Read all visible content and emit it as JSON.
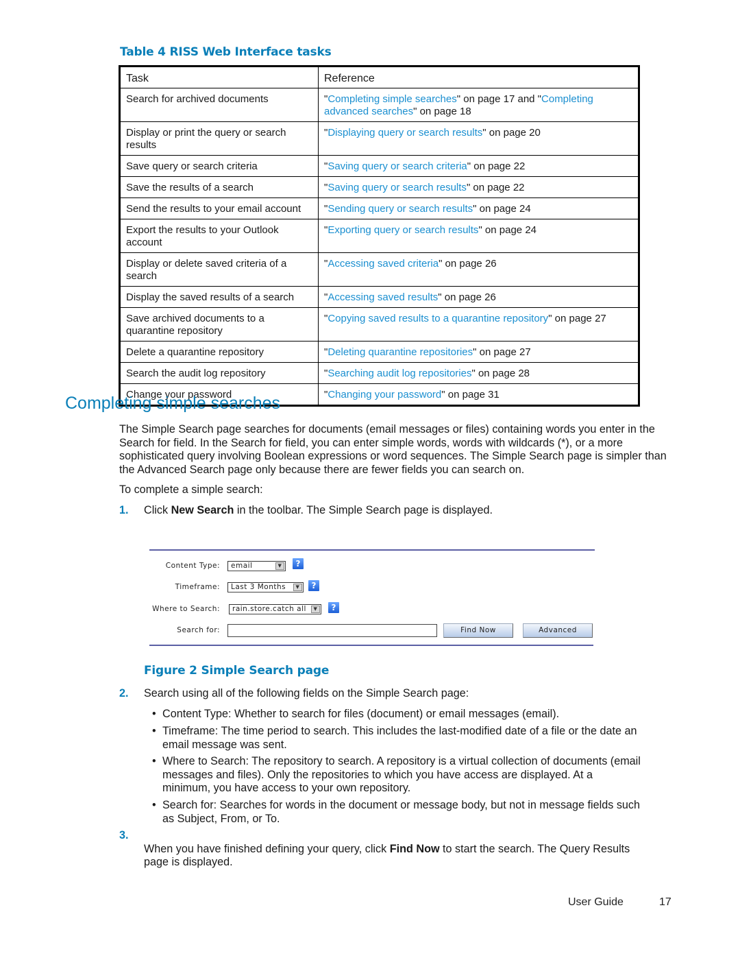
{
  "table": {
    "caption": "Table 4 RISS Web Interface tasks",
    "headers": [
      "Task",
      "Reference"
    ],
    "rows": [
      {
        "task": "Search for archived documents",
        "ref_pre": "\"",
        "link": "Completing simple searches",
        "ref_mid": "\" on page 17 and \"",
        "link2": "Completing advanced searches",
        "ref_post": "\" on page 18"
      },
      {
        "task": "Display or print the query or search results",
        "ref_pre": "\"",
        "link": "Displaying query or search results",
        "ref_post": "\" on page 20"
      },
      {
        "task": "Save query or search criteria",
        "ref_pre": "\"",
        "link": "Saving query or search criteria",
        "ref_post": "\" on page 22"
      },
      {
        "task": "Save the results of a search",
        "ref_pre": "\"",
        "link": "Saving query or search results",
        "ref_post": "\" on page 22"
      },
      {
        "task": "Send the results to your email account",
        "ref_pre": "\"",
        "link": "Sending query or search results",
        "ref_post": "\" on page 24"
      },
      {
        "task": "Export the results to your Outlook account",
        "ref_pre": "\"",
        "link": "Exporting query or search results",
        "ref_post": "\" on page 24"
      },
      {
        "task": "Display or delete saved criteria of a search",
        "ref_pre": "\"",
        "link": "Accessing saved criteria",
        "ref_post": "\" on page 26"
      },
      {
        "task": "Display the saved results of a search",
        "ref_pre": "\"",
        "link": "Accessing saved results",
        "ref_post": "\" on page 26"
      },
      {
        "task": "Save archived documents to a quarantine repository",
        "ref_pre": "\"",
        "link": "Copying saved results to a quarantine repository",
        "ref_post": "\" on page 27"
      },
      {
        "task": "Delete a quarantine repository",
        "ref_pre": "\"",
        "link": "Deleting quarantine repositories",
        "ref_post": "\" on page 27"
      },
      {
        "task": "Search the audit log repository",
        "ref_pre": "\"",
        "link": "Searching audit log repositories",
        "ref_post": "\" on page 28"
      },
      {
        "task": "Change your password",
        "ref_pre": "\"",
        "link": "Changing your password",
        "ref_post": "\" on page 31"
      }
    ]
  },
  "section": {
    "title": "Completing simple searches",
    "intro": "The Simple Search page searches for documents (email messages or files) containing words you enter in the Search for field. In the Search for field, you can enter simple words, words with wildcards (*), or a more sophisticated query involving Boolean expressions or word sequences. The Simple Search page is simpler than the Advanced Search page only because there are fewer fields you can search on.",
    "lead": "To complete a simple search:",
    "step1": {
      "num": "1.",
      "pre": "Click ",
      "bold": "New Search",
      "post": " in the toolbar. The Simple Search page is displayed."
    },
    "step2": {
      "num": "2.",
      "text": "Search using all of the following fields on the Simple Search page:"
    },
    "bullets": [
      "Content Type: Whether to search for files (document) or email messages (email).",
      "Timeframe: The time period to search. This includes the last-modified date of a file or the date an email message was sent.",
      "Where to Search: The repository to search. A repository is a virtual collection of documents (email messages and files). Only the repositories to which you have access are displayed. At a minimum, you have access to your own repository.",
      "Search for: Searches for words in the document or message body, but not in message fields such as Subject, From, or To."
    ],
    "step3": {
      "num": "3.",
      "pre": "When you have finished defining your query, click ",
      "bold": "Find Now",
      "post": " to start the search. The Query Results page is displayed."
    }
  },
  "figure": {
    "caption": "Figure 2 Simple Search page",
    "content_type_label": "Content Type:",
    "content_type_value": "email",
    "timeframe_label": "Timeframe:",
    "timeframe_value": "Last 3 Months",
    "where_label": "Where to Search:",
    "where_value": "rain.store.catch all",
    "search_for_label": "Search for:",
    "search_for_value": "",
    "help_glyph": "?",
    "dropdown_glyph": "▼",
    "find_now_label": "Find Now",
    "advanced_label": "Advanced"
  },
  "footer": {
    "label": "User Guide",
    "page": "17"
  }
}
